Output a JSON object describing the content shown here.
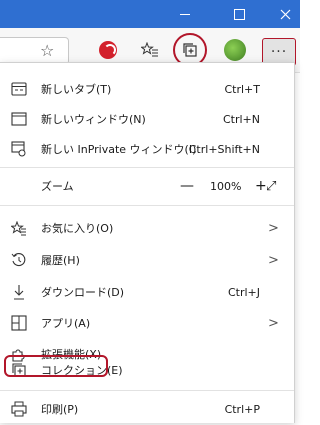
{
  "window": {
    "minimize_icon": "minimize-icon",
    "maximize_icon": "maximize-icon",
    "close_icon": "close-icon"
  },
  "toolbar": {
    "addr_star_icon": "star-outline-icon",
    "extension_icon": "trend-micro-extension-icon",
    "favorites_icon": "favorites-bar-icon",
    "collections_icon": "collections-icon",
    "profile_icon": "profile-avatar-icon",
    "more_label": "···"
  },
  "menu": {
    "items": [
      {
        "label": "新しいタブ(T)",
        "shortcut": "Ctrl+T",
        "icon": "new-tab-icon"
      },
      {
        "label": "新しいウィンドウ(N)",
        "shortcut": "Ctrl+N",
        "icon": "new-window-icon"
      },
      {
        "label": "新しい InPrivate ウィンドウ(I)",
        "shortcut": "Ctrl+Shift+N",
        "icon": "inprivate-icon"
      }
    ],
    "zoom": {
      "label": "ズーム",
      "minus": "—",
      "value": "100%",
      "plus": "+",
      "fullscreen": "⤢"
    },
    "items2": [
      {
        "label": "お気に入り(O)",
        "shortcut": "",
        "icon": "favorites-icon",
        "submenu": true
      },
      {
        "label": "履歴(H)",
        "shortcut": "",
        "icon": "history-icon",
        "submenu": true
      },
      {
        "label": "ダウンロード(D)",
        "shortcut": "Ctrl+J",
        "icon": "download-icon",
        "submenu": false
      },
      {
        "label": "アプリ(A)",
        "shortcut": "",
        "icon": "apps-icon",
        "submenu": true
      },
      {
        "label": "拡張機能(X)",
        "shortcut": "",
        "icon": "extensions-icon",
        "submenu": false
      },
      {
        "label": "コレクション(E)",
        "shortcut": "",
        "icon": "collections-icon",
        "submenu": false
      },
      {
        "label": "印刷(P)",
        "shortcut": "Ctrl+P",
        "icon": "print-icon",
        "submenu": false
      }
    ],
    "chevron": ">"
  },
  "colors": {
    "titlebar": "#2f6fd1",
    "highlight": "#b2162a"
  }
}
